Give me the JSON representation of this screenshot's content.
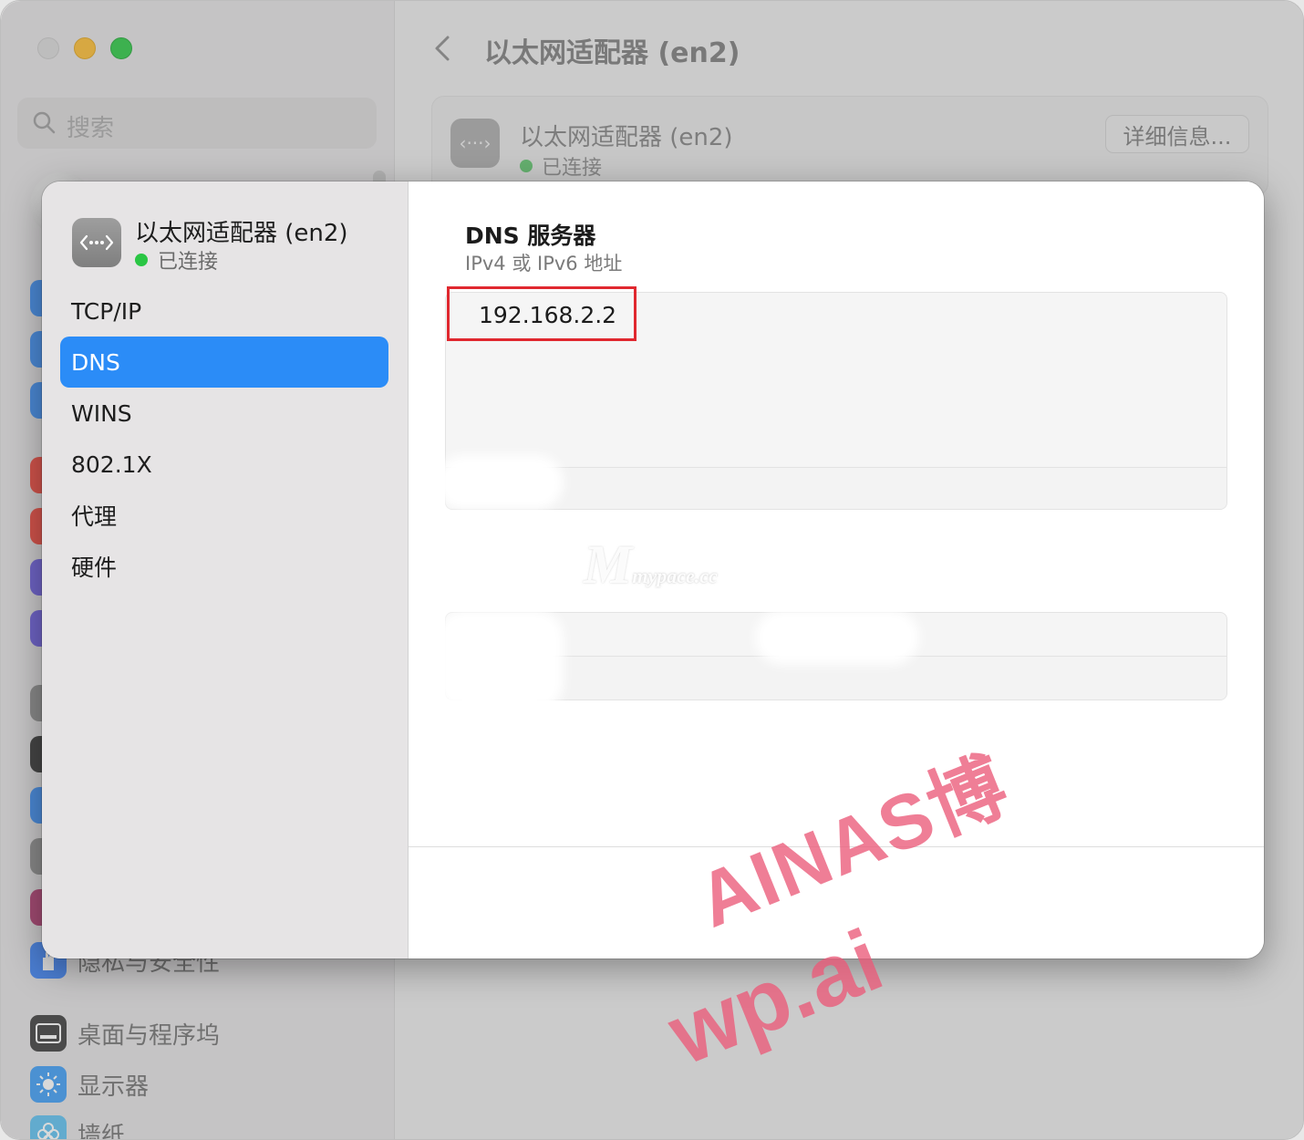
{
  "window": {
    "title": "以太网适配器 (en2)",
    "search_placeholder": "搜索"
  },
  "background_sidebar": {
    "items": [
      {
        "label": "隐私与安全性",
        "icon": "hand-icon",
        "color": "#3b82f6"
      },
      {
        "label": "桌面与程序坞",
        "icon": "dock-icon",
        "color": "#3a3a3a"
      },
      {
        "label": "显示器",
        "icon": "sun-icon",
        "color": "#3b9cf5"
      },
      {
        "label": "墙纸",
        "icon": "flower-icon",
        "color": "#5bc0f0"
      }
    ]
  },
  "background_card": {
    "name": "以太网适配器 (en2)",
    "status": "已连接",
    "details_button": "详细信息..."
  },
  "sheet": {
    "adapter_name": "以太网适配器 (en2)",
    "status": "已连接",
    "nav": [
      "TCP/IP",
      "DNS",
      "WINS",
      "802.1X",
      "代理",
      "硬件"
    ],
    "active_nav": "DNS",
    "dns_title": "DNS 服务器",
    "dns_subtitle": "IPv4 或 IPv6 地址",
    "dns_servers": [
      "192.168.2.2"
    ],
    "status_color": "#2ac644",
    "accent_color": "#2b8cf7",
    "highlight_color": "#e0282f"
  },
  "watermarks": {
    "top": "AINAS博",
    "bottom": "wp.ai",
    "logo": "M",
    "logo_sub": "mypace.cc"
  }
}
